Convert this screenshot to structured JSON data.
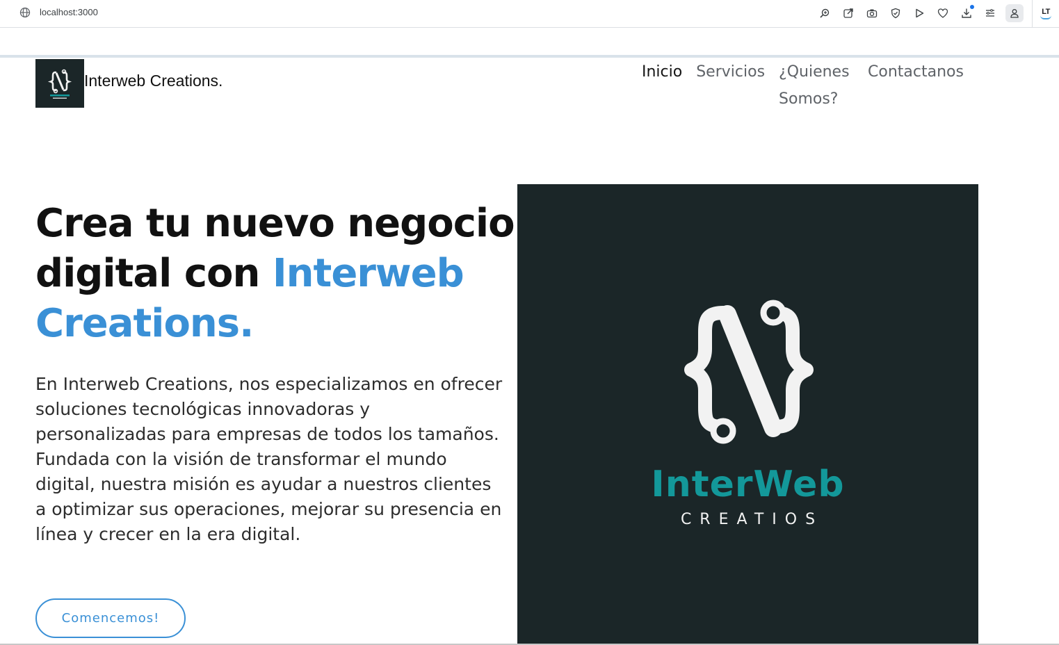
{
  "browser": {
    "url": "localhost:3000",
    "toolbar_icons": [
      "zoom-icon",
      "share-icon",
      "camera-icon",
      "shield-icon",
      "play-icon",
      "heart-icon",
      "download-icon",
      "menu-icon",
      "profile-icon"
    ],
    "extension_label": "LT"
  },
  "header": {
    "brand": "Interweb Creations.",
    "nav": [
      {
        "label": "Inicio",
        "active": true
      },
      {
        "label": "Servicios",
        "active": false
      },
      {
        "label": "¿Quienes Somos?",
        "active": false
      },
      {
        "label": "Contactanos",
        "active": false
      }
    ]
  },
  "hero": {
    "title_main": "Crea tu nuevo negocio digital con ",
    "title_accent": "Interweb Creations.",
    "text": "En Interweb Creations, nos especializamos en ofrecer soluciones tecnológicas innovadoras y personalizadas para empresas de todos los tamaños. Fundada con la visión de transformar el mundo digital, nuestra misión es ayudar a nuestros clientes a optimizar sus operaciones, mejorar su presencia en línea y crecer en la era digital.",
    "cta": "Comencemos!",
    "image_brand": "InterWeb",
    "image_sub": "CREATIOS"
  },
  "colors": {
    "accent": "#3a90d6",
    "logo_bg": "#1b2628",
    "logo_teal": "#13989a"
  }
}
